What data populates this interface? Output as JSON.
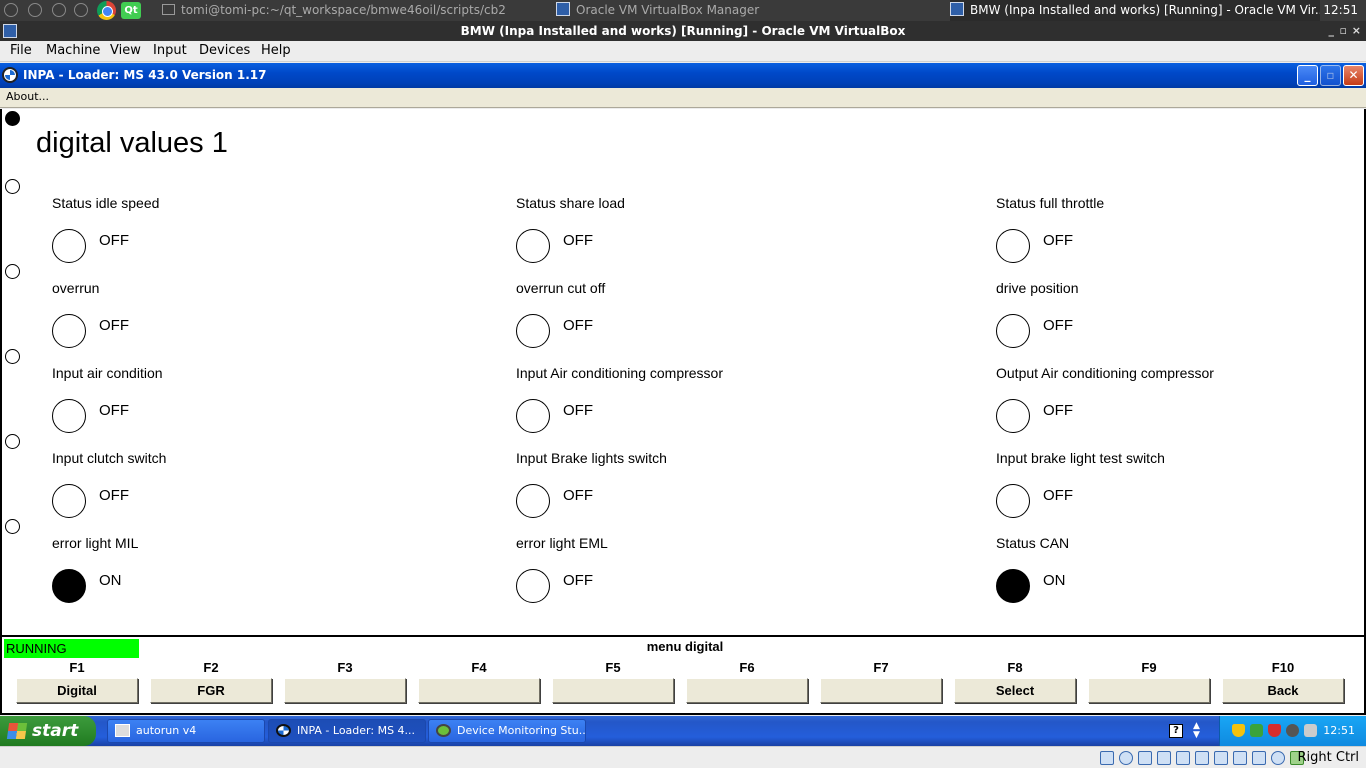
{
  "host_panel": {
    "tasks": [
      {
        "label": "tomi@tomi-pc:~/qt_workspace/bmwe46oil/scripts/cb2"
      },
      {
        "label": "Oracle VM VirtualBox Manager"
      },
      {
        "label": "BMW (Inpa Installed and works) [Running] - Oracle VM Vir..."
      }
    ],
    "clock": "12:51"
  },
  "vbox": {
    "title": "BMW (Inpa Installed and works) [Running] - Oracle VM VirtualBox",
    "menu": [
      "File",
      "Machine",
      "View",
      "Input",
      "Devices",
      "Help"
    ],
    "window_controls": {
      "minimize": "_",
      "maximize": "▫",
      "close": "×"
    },
    "status_right": "Right Ctrl"
  },
  "inpa": {
    "title": "INPA - Loader:  MS 43.0 Version 1.17",
    "menu_about": "About...",
    "page_title": "digital values 1",
    "signals": [
      {
        "label": "Status idle speed",
        "state": "OFF",
        "on": false
      },
      {
        "label": "Status share load",
        "state": "OFF",
        "on": false
      },
      {
        "label": "Status full throttle",
        "state": "OFF",
        "on": false
      },
      {
        "label": "overrun",
        "state": "OFF",
        "on": false
      },
      {
        "label": " overrun cut off",
        "state": "OFF",
        "on": false
      },
      {
        "label": "drive position",
        "state": "OFF",
        "on": false
      },
      {
        "label": "Input air condition",
        "state": "OFF",
        "on": false
      },
      {
        "label": "Input Air conditioning compressor",
        "state": "OFF",
        "on": false
      },
      {
        "label": "Output Air conditioning compressor",
        "state": "OFF",
        "on": false
      },
      {
        "label": "Input clutch switch",
        "state": "OFF",
        "on": false
      },
      {
        "label": "Input Brake lights switch",
        "state": "OFF",
        "on": false
      },
      {
        "label": "Input brake light test switch",
        "state": "OFF",
        "on": false
      },
      {
        "label": "error light MIL",
        "state": "ON",
        "on": true
      },
      {
        "label": " error light EML",
        "state": "OFF",
        "on": false
      },
      {
        "label": "Status CAN",
        "state": "ON",
        "on": true
      }
    ],
    "status": "RUNNING",
    "status_color": "#00ff00",
    "menu_label": "menu digital",
    "fkeys": [
      {
        "key": "F1",
        "label": "Digital"
      },
      {
        "key": "F2",
        "label": "FGR"
      },
      {
        "key": "F3",
        "label": ""
      },
      {
        "key": "F4",
        "label": ""
      },
      {
        "key": "F5",
        "label": ""
      },
      {
        "key": "F6",
        "label": ""
      },
      {
        "key": "F7",
        "label": ""
      },
      {
        "key": "F8",
        "label": "Select"
      },
      {
        "key": "F9",
        "label": ""
      },
      {
        "key": "F10",
        "label": "Back"
      }
    ]
  },
  "xp": {
    "start": "start",
    "tasks": [
      {
        "label": "autorun v4"
      },
      {
        "label": "INPA - Loader:  MS 4..."
      },
      {
        "label": "Device Monitoring Stu..."
      }
    ],
    "help_icon": "?",
    "clock": "12:51"
  }
}
